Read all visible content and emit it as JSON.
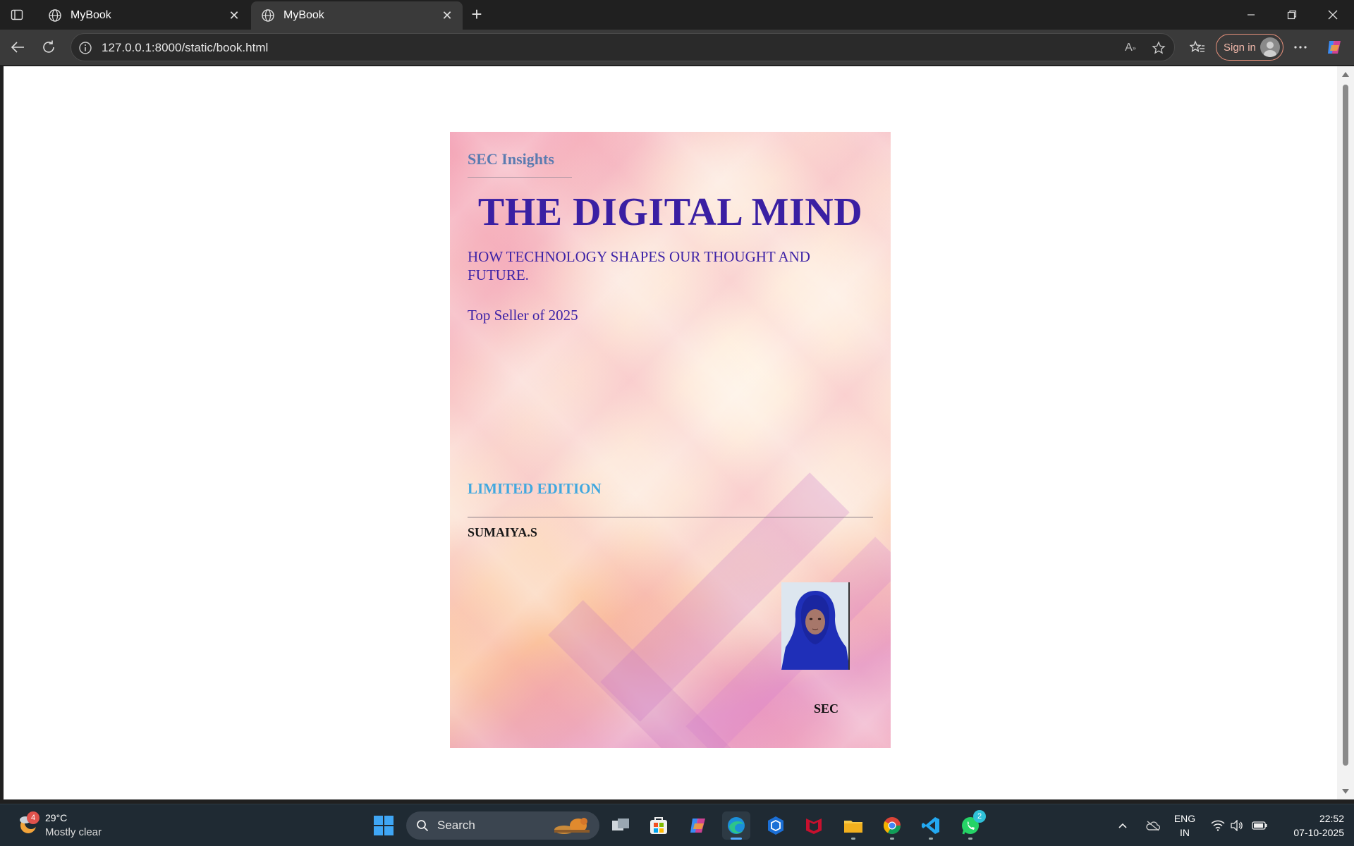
{
  "browser": {
    "tabs": [
      {
        "label": "MyBook",
        "active": false
      },
      {
        "label": "MyBook",
        "active": true
      }
    ],
    "address": {
      "url": "127.0.0.1:8000/static/book.html"
    },
    "signin_label": "Sign in"
  },
  "book": {
    "brand": "SEC Insights",
    "title": "THE DIGITAL MIND",
    "subtitle": "HOW TECHNOLOGY SHAPES OUR THOUGHT AND FUTURE.",
    "tagline": "Top Seller of 2025",
    "edition": "LIMITED EDITION",
    "author": "SUMAIYA.S",
    "publisher": "SEC"
  },
  "taskbar": {
    "weather": {
      "temp": "29°C",
      "condition": "Mostly clear",
      "badge": "4"
    },
    "search_placeholder": "Search",
    "whatsapp_badge": "2",
    "lang_line1": "ENG",
    "lang_line2": "IN",
    "time": "22:52",
    "date": "07-10-2025"
  },
  "colors": {
    "title": "#3a1fa3",
    "edition": "#41a8df",
    "brand": "#5b7bb0",
    "accent": "#55aaff"
  }
}
